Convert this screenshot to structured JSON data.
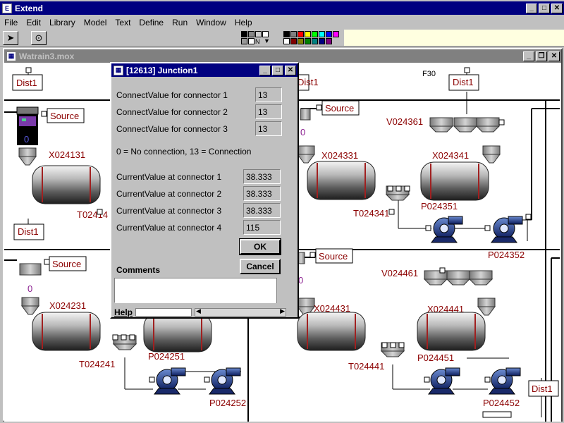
{
  "app": {
    "title": "Extend"
  },
  "menu": [
    "File",
    "Edit",
    "Library",
    "Model",
    "Text",
    "Define",
    "Run",
    "Window",
    "Help"
  ],
  "document": {
    "title": "Watrain3.mox"
  },
  "dialog": {
    "title": "[12613]   Junction1",
    "connect_rows": [
      {
        "label": "ConnectValue for connector 1",
        "value": "13"
      },
      {
        "label": "ConnectValue for connector 2",
        "value": "13"
      },
      {
        "label": "ConnectValue for connector 3",
        "value": "13"
      }
    ],
    "legend": "0 = No connection, 13 = Connection",
    "current_rows": [
      {
        "label": "CurrentValue at connector 1",
        "value": "38.333"
      },
      {
        "label": "CurrentValue at connector 2",
        "value": "38.333"
      },
      {
        "label": "CurrentValue at connector 3",
        "value": "38.333"
      },
      {
        "label": "CurrentValue at connector 4",
        "value": "115"
      }
    ],
    "ok_label": "OK",
    "cancel_label": "Cancel",
    "comments_label": "Comments",
    "help_label": "Help"
  },
  "model_labels": {
    "dist_a": "Dist1",
    "dist_b": "Dist1",
    "dist_c": "Dist1",
    "dist_d": "Dist1",
    "dist_e": "Dist1",
    "source_a": "Source",
    "source_b": "Source",
    "source_c": "Source",
    "source_d": "Source",
    "f30": "F30",
    "x024131": "X024131",
    "x024231": "X024231",
    "x024331": "X024331",
    "x024341": "X024341",
    "x024431": "X024431",
    "x024441": "X024441",
    "v024361": "V024361",
    "v024461": "V024461",
    "t02414": "T02414",
    "t024241": "T024241",
    "t024341": "T024341",
    "t024441": "T024441",
    "p024351": "P024351",
    "p024352": "P024352",
    "p024251": "P024251",
    "p024252": "P024252",
    "p024451": "P024451",
    "p024452": "P024452",
    "zero_a": "0",
    "zero_b": "0",
    "zero_c": "0",
    "zero_d": "0"
  },
  "colors": {
    "titlebar_active": "#000080",
    "titlebar_inactive": "#808080",
    "label_red": "#8b0000",
    "palette": [
      "#000000",
      "#808080",
      "#ff0000",
      "#ffff00",
      "#00ff00",
      "#00ffff",
      "#0000ff",
      "#ff00ff",
      "#ffffff",
      "#800000",
      "#808000",
      "#008000",
      "#008080",
      "#000080",
      "#800080"
    ]
  }
}
